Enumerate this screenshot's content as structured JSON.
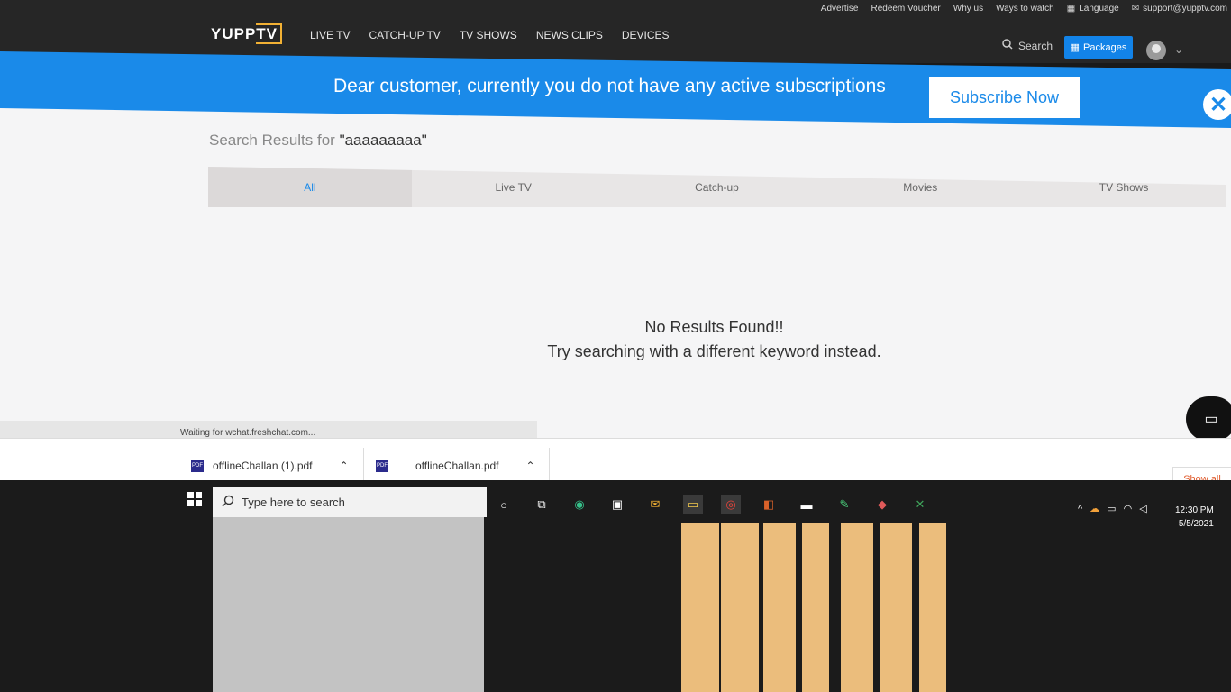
{
  "header": {
    "util_links": [
      "Advertise",
      "Redeem Voucher",
      "Why us",
      "Ways to watch",
      "Language",
      "support@yupptv.com"
    ],
    "logo": {
      "main": "YUPP",
      "tv": "TV"
    },
    "nav": [
      "LIVE TV",
      "CATCH-UP TV",
      "TV SHOWS",
      "NEWS CLIPS",
      "DEVICES"
    ],
    "search_label": "Search",
    "packages_label": "Packages"
  },
  "banner": {
    "text": "Dear customer, currently you do not have any active subscriptions",
    "subscribe_label": "Subscribe Now",
    "close_glyph": "✕"
  },
  "results": {
    "title_prefix": "Search Results for ",
    "query": "\"aaaaaaaaa\"",
    "tabs": [
      {
        "label": "All",
        "active": true
      },
      {
        "label": "Live TV"
      },
      {
        "label": "Catch-up"
      },
      {
        "label": "Movies"
      },
      {
        "label": "TV Shows"
      }
    ],
    "no_results_line1": "No Results Found!!",
    "no_results_line2": "Try searching with a different keyword instead."
  },
  "status": {
    "text": "Waiting for wchat.freshchat.com..."
  },
  "downloads": {
    "items": [
      {
        "file": "offlineChallan (1).pdf"
      },
      {
        "file": "offlineChallan.pdf"
      }
    ],
    "show_all": "Show all"
  },
  "taskbar": {
    "search_placeholder": "Type here to search",
    "clock_time": "12:30 PM",
    "clock_date": "5/5/2021"
  },
  "colors": {
    "accent": "#1a8ae9",
    "header_bg": "#262626",
    "show_all": "#e05a2b"
  }
}
